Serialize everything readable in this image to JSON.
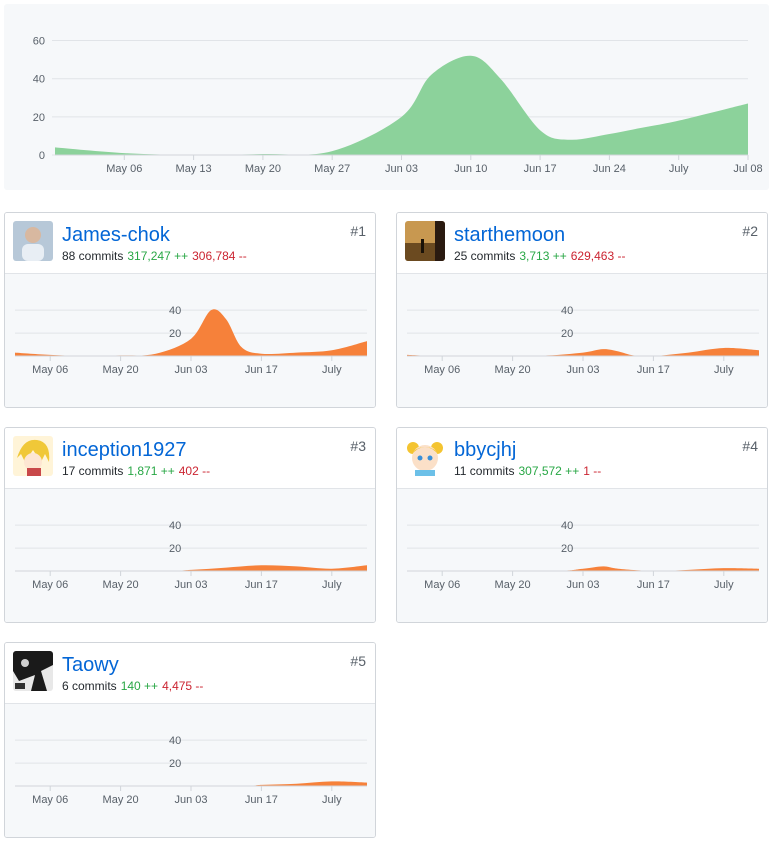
{
  "main_chart": {
    "chart_data": {
      "type": "area",
      "color": "#8cd29b",
      "x_labels": [
        "May 06",
        "May 13",
        "May 20",
        "May 27",
        "Jun 03",
        "Jun 10",
        "Jun 17",
        "Jun 24",
        "July",
        "Jul 08"
      ],
      "y_ticks": [
        0,
        20,
        40,
        60
      ],
      "ylim": [
        0,
        65
      ],
      "x_start": "Apr 29",
      "x_end": "Jul 08",
      "points": [
        [
          "Apr 29",
          4
        ],
        [
          "May 06",
          1
        ],
        [
          "May 13",
          0
        ],
        [
          "May 20",
          0.5
        ],
        [
          "May 27",
          2
        ],
        [
          "Jun 03",
          20
        ],
        [
          "Jun 06",
          42
        ],
        [
          "Jun 10",
          52
        ],
        [
          "Jun 13",
          40
        ],
        [
          "Jun 17",
          13
        ],
        [
          "Jun 20",
          8
        ],
        [
          "Jun 24",
          11
        ],
        [
          "Jun 27",
          14
        ],
        [
          "July",
          18
        ],
        [
          "Jul 08",
          27
        ]
      ]
    }
  },
  "contributors": [
    {
      "username": "James-chok",
      "commits": "88 commits",
      "additions": "317,247 ++",
      "deletions": "306,784 --",
      "rank": "#1",
      "avatar_icon": "person-photo-avatar",
      "chart_data": {
        "type": "area",
        "color": "#f6813a",
        "x_labels": [
          "May 06",
          "May 20",
          "Jun 03",
          "Jun 17",
          "July"
        ],
        "y_ticks": [
          20,
          40
        ],
        "ylim": [
          0,
          48
        ],
        "points": [
          [
            "Apr 29",
            3
          ],
          [
            "May 06",
            1
          ],
          [
            "May 13",
            0
          ],
          [
            "May 20",
            0.5
          ],
          [
            "May 27",
            2
          ],
          [
            "Jun 03",
            15
          ],
          [
            "Jun 07",
            40
          ],
          [
            "Jun 10",
            32
          ],
          [
            "Jun 13",
            8
          ],
          [
            "Jun 17",
            2
          ],
          [
            "Jun 24",
            3
          ],
          [
            "July",
            5
          ],
          [
            "Jul 08",
            13
          ]
        ]
      }
    },
    {
      "username": "starthemoon",
      "commits": "25 commits",
      "additions": "3,713 ++",
      "deletions": "629,463 --",
      "rank": "#2",
      "avatar_icon": "sunset-photo-avatar",
      "chart_data": {
        "type": "area",
        "color": "#f6813a",
        "x_labels": [
          "May 06",
          "May 20",
          "Jun 03",
          "Jun 17",
          "July"
        ],
        "y_ticks": [
          20,
          40
        ],
        "ylim": [
          0,
          48
        ],
        "points": [
          [
            "Apr 29",
            1
          ],
          [
            "May 06",
            0
          ],
          [
            "May 20",
            0
          ],
          [
            "May 27",
            0.5
          ],
          [
            "Jun 03",
            3
          ],
          [
            "Jun 07",
            6
          ],
          [
            "Jun 10",
            4
          ],
          [
            "Jun 13",
            0.5
          ],
          [
            "Jun 17",
            0
          ],
          [
            "Jun 24",
            3
          ],
          [
            "July",
            7
          ],
          [
            "Jul 08",
            5
          ]
        ]
      }
    },
    {
      "username": "inception1927",
      "commits": "17 commits",
      "additions": "1,871 ++",
      "deletions": "402 --",
      "rank": "#3",
      "avatar_icon": "anime-avatar",
      "chart_data": {
        "type": "area",
        "color": "#f6813a",
        "x_labels": [
          "May 06",
          "May 20",
          "Jun 03",
          "Jun 17",
          "July"
        ],
        "y_ticks": [
          20,
          40
        ],
        "ylim": [
          0,
          48
        ],
        "points": [
          [
            "Apr 29",
            0
          ],
          [
            "May 27",
            0
          ],
          [
            "Jun 03",
            1
          ],
          [
            "Jun 10",
            3
          ],
          [
            "Jun 17",
            5
          ],
          [
            "Jun 24",
            4
          ],
          [
            "July",
            2
          ],
          [
            "Jul 08",
            5
          ]
        ]
      }
    },
    {
      "username": "bbycjhj",
      "commits": "11 commits",
      "additions": "307,572 ++",
      "deletions": "1 --",
      "rank": "#4",
      "avatar_icon": "cartoon-girl-avatar",
      "chart_data": {
        "type": "area",
        "color": "#f6813a",
        "x_labels": [
          "May 06",
          "May 20",
          "Jun 03",
          "Jun 17",
          "July"
        ],
        "y_ticks": [
          20,
          40
        ],
        "ylim": [
          0,
          48
        ],
        "points": [
          [
            "Apr 29",
            0
          ],
          [
            "May 27",
            0
          ],
          [
            "Jun 03",
            2
          ],
          [
            "Jun 07",
            4
          ],
          [
            "Jun 10",
            2
          ],
          [
            "Jun 17",
            0
          ],
          [
            "Jun 24",
            1
          ],
          [
            "July",
            2.5
          ],
          [
            "Jul 08",
            2
          ]
        ]
      }
    },
    {
      "username": "Taowy",
      "commits": "6 commits",
      "additions": "140 ++",
      "deletions": "4,475 --",
      "rank": "#5",
      "avatar_icon": "dark-art-avatar",
      "chart_data": {
        "type": "area",
        "color": "#f6813a",
        "x_labels": [
          "May 06",
          "May 20",
          "Jun 03",
          "Jun 17",
          "July"
        ],
        "y_ticks": [
          20,
          40
        ],
        "ylim": [
          0,
          48
        ],
        "points": [
          [
            "Apr 29",
            0
          ],
          [
            "Jun 10",
            0
          ],
          [
            "Jun 17",
            1
          ],
          [
            "Jun 24",
            2
          ],
          [
            "July",
            4
          ],
          [
            "Jul 08",
            3
          ]
        ]
      }
    }
  ]
}
